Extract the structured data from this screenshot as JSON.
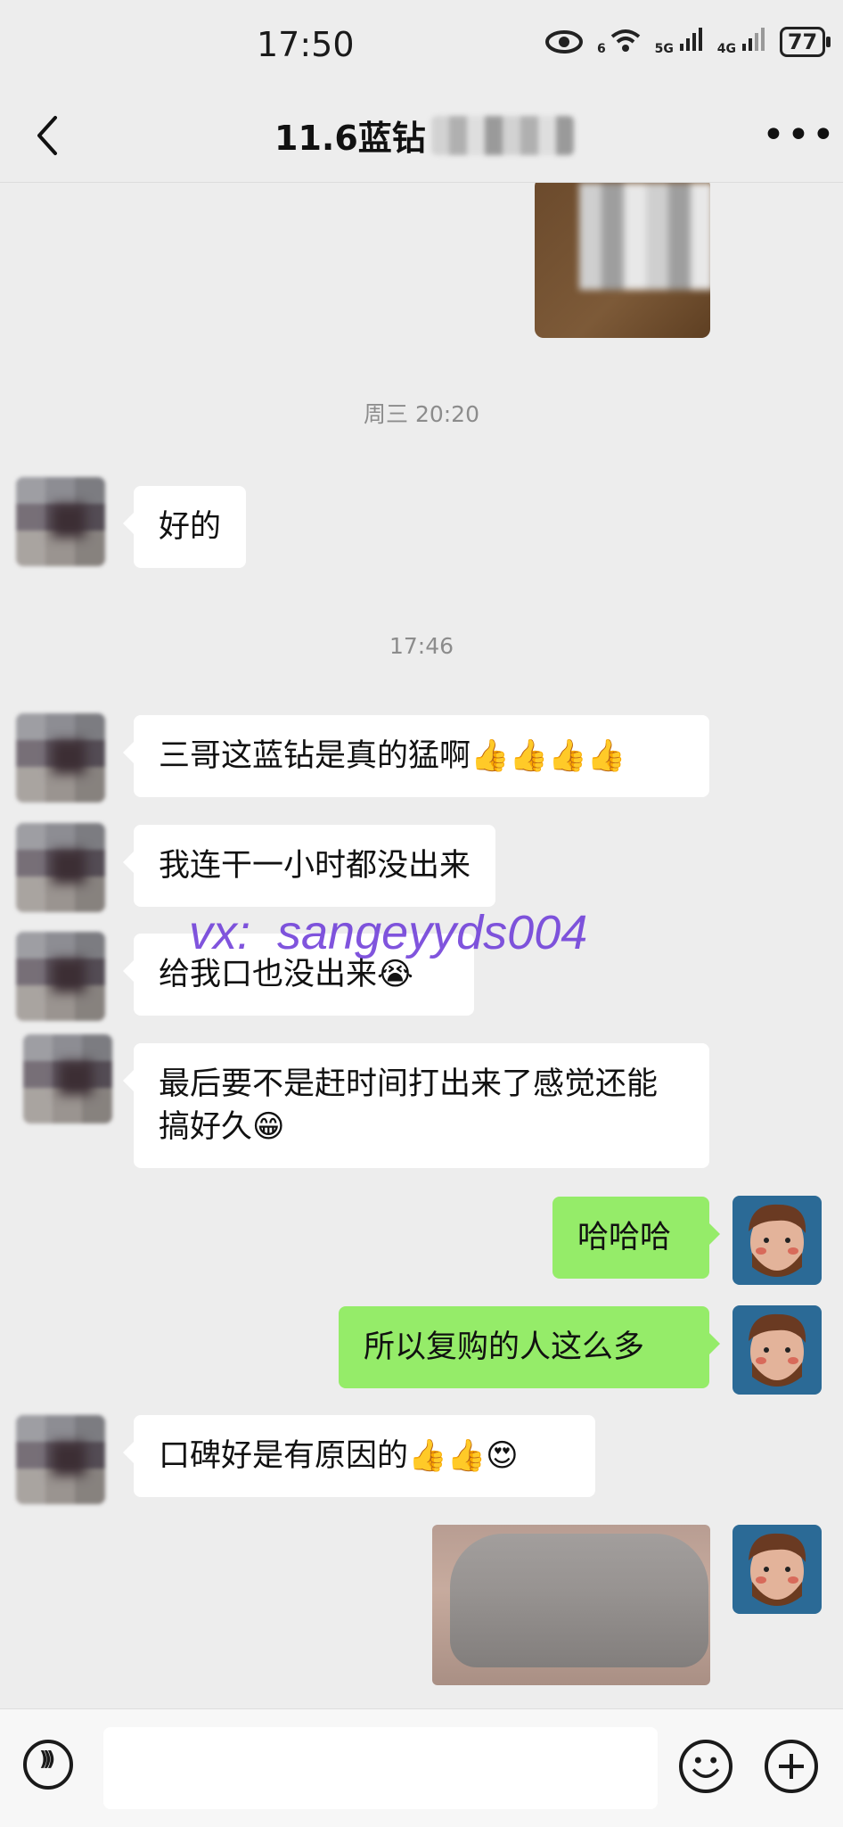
{
  "status_bar": {
    "time": "17:50",
    "battery": "77",
    "network_labels": [
      "6",
      "5G",
      "4G"
    ],
    "icons": [
      "eye-icon",
      "wifi-icon",
      "signal-5g-icon",
      "signal-4g-icon",
      "battery-icon"
    ]
  },
  "header": {
    "title": "11.6蓝钻",
    "icons": [
      "back-chevron-icon",
      "more-dots-icon"
    ]
  },
  "messages": [
    {
      "type": "timestamp",
      "text": "周三 20:20"
    },
    {
      "type": "text",
      "side": "left",
      "text": "好的"
    },
    {
      "type": "timestamp",
      "text": "17:46"
    },
    {
      "type": "text",
      "side": "left",
      "text": "三哥这蓝钻是真的猛啊👍👍👍👍"
    },
    {
      "type": "text",
      "side": "left",
      "text": "我连干一小时都没出来"
    },
    {
      "type": "text",
      "side": "left",
      "text": "给我口也没出来😭"
    },
    {
      "type": "text",
      "side": "left",
      "text": "最后要不是赶时间打出来了感觉还能搞好久😁"
    },
    {
      "type": "text",
      "side": "right",
      "text": "哈哈哈"
    },
    {
      "type": "text",
      "side": "right",
      "text": "所以复购的人这么多"
    },
    {
      "type": "text",
      "side": "left",
      "text": "口碑好是有原因的👍👍😍"
    }
  ],
  "watermark": "vx:  sangeyyds004",
  "input_bar": {
    "icons": [
      "voice-icon",
      "emoji-icon",
      "plus-icon"
    ]
  },
  "colors": {
    "background": "#ededed",
    "outgoing_bubble": "#95ec69",
    "incoming_bubble": "#ffffff",
    "watermark": "#6a37d8"
  }
}
